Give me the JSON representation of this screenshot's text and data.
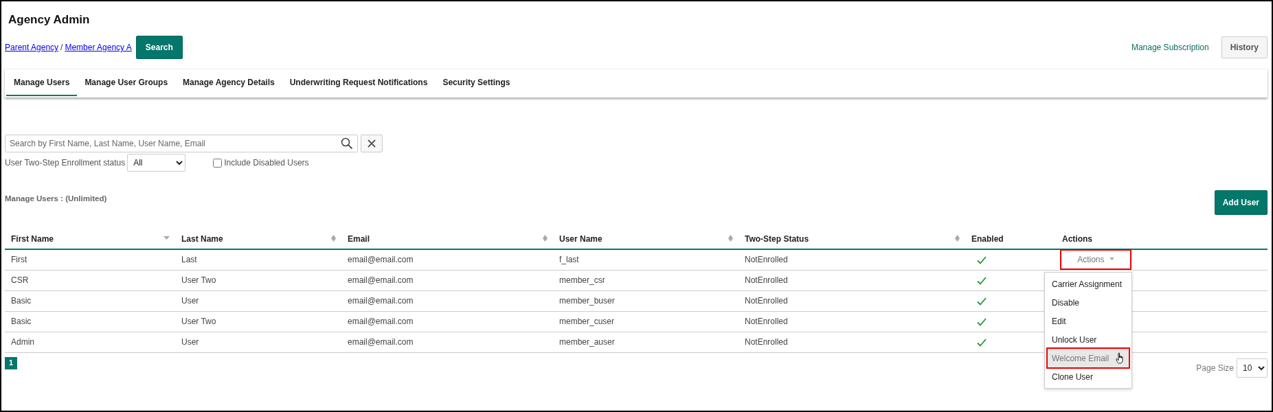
{
  "title": "Agency Admin",
  "breadcrumb": [
    "Parent Agency",
    "Member Agency A"
  ],
  "breadcrumb_separator": "/",
  "search_button": "Search",
  "manage_subscription": "Manage Subscription",
  "history_button": "History",
  "tabs": [
    {
      "label": "Manage Users",
      "selected": true
    },
    {
      "label": "Manage User Groups",
      "selected": false
    },
    {
      "label": "Manage Agency Details",
      "selected": false
    },
    {
      "label": "Underwriting Request Notifications",
      "selected": false
    },
    {
      "label": "Security Settings",
      "selected": false
    }
  ],
  "user_search": {
    "placeholder": "Search by First Name, Last Name, User Name, Email"
  },
  "enrollment_filter": {
    "label": "User Two-Step Enrollment status",
    "value": "All"
  },
  "include_disabled": {
    "label": "Include Disabled Users",
    "checked": false
  },
  "users_label": "Manage Users : (Unlimited)",
  "add_user_button": "Add User",
  "table": {
    "columns": [
      {
        "label": "First Name",
        "sortable": true,
        "sorted": true
      },
      {
        "label": "Last Name",
        "sortable": true,
        "sorted": false
      },
      {
        "label": "Email",
        "sortable": true,
        "sorted": false
      },
      {
        "label": "User Name",
        "sortable": true,
        "sorted": false
      },
      {
        "label": "Two-Step Status",
        "sortable": true,
        "sorted": false
      },
      {
        "label": "Enabled",
        "sortable": false,
        "sorted": false
      },
      {
        "label": "Actions",
        "sortable": false,
        "sorted": false
      }
    ],
    "rows": [
      {
        "first_name": "First",
        "last_name": "Last",
        "email": "email@email.com",
        "user_name": "f_last",
        "two_step_status": "NotEnrolled",
        "enabled": true,
        "actions": "Actions",
        "highlighted": true
      },
      {
        "first_name": "CSR",
        "last_name": "User Two",
        "email": "email@email.com",
        "user_name": "member_csr",
        "two_step_status": "NotEnrolled",
        "enabled": true
      },
      {
        "first_name": "Basic",
        "last_name": "User",
        "email": "email@email.com",
        "user_name": "member_buser",
        "two_step_status": "NotEnrolled",
        "enabled": true
      },
      {
        "first_name": "Basic",
        "last_name": "User Two",
        "email": "email@email.com",
        "user_name": "member_cuser",
        "two_step_status": "NotEnrolled",
        "enabled": true
      },
      {
        "first_name": "Admin",
        "last_name": "User",
        "email": "email@email.com",
        "user_name": "member_auser",
        "two_step_status": "NotEnrolled",
        "enabled": true
      }
    ]
  },
  "actions_menu": [
    {
      "label": "Carrier Assignment",
      "hovered": false,
      "highlighted": false
    },
    {
      "label": "Disable",
      "hovered": false,
      "highlighted": false
    },
    {
      "label": "Edit",
      "hovered": false,
      "highlighted": false
    },
    {
      "label": "Unlock User",
      "hovered": false,
      "highlighted": false
    },
    {
      "label": "Welcome Email",
      "hovered": true,
      "highlighted": true
    },
    {
      "label": "Clone User",
      "hovered": false,
      "highlighted": false
    }
  ],
  "pagination": [
    {
      "label": "1",
      "selected": true
    }
  ],
  "page_size": {
    "label": "Page Size",
    "value": "10"
  }
}
